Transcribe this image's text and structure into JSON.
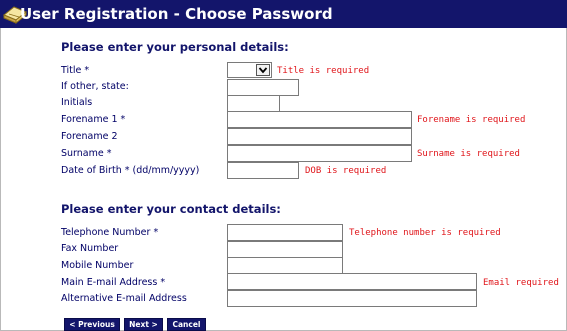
{
  "title": "User Registration - Choose Password",
  "personal": {
    "heading": "Please enter your personal details:",
    "fields": {
      "title": {
        "label": "Title *",
        "error": "Title is required",
        "value": ""
      },
      "other_state": {
        "label": "If other, state:",
        "value": ""
      },
      "initials": {
        "label": "Initials",
        "value": ""
      },
      "forename1": {
        "label": "Forename 1 *",
        "error": "Forename is required",
        "value": ""
      },
      "forename2": {
        "label": "Forename 2",
        "value": ""
      },
      "surname": {
        "label": "Surname *",
        "error": "Surname is required",
        "value": ""
      },
      "dob": {
        "label": "Date of Birth * (dd/mm/yyyy)",
        "error": "DOB is required",
        "value": ""
      }
    }
  },
  "contact": {
    "heading": "Please enter your contact details:",
    "fields": {
      "telephone": {
        "label": "Telephone Number *",
        "error": "Telephone number is required",
        "value": ""
      },
      "fax": {
        "label": "Fax Number",
        "value": ""
      },
      "mobile": {
        "label": "Mobile Number",
        "value": ""
      },
      "email": {
        "label": "Main E-mail Address *",
        "error": "Email required",
        "value": ""
      },
      "alt_email": {
        "label": "Alternative E-mail Address",
        "value": ""
      }
    }
  },
  "buttons": {
    "previous": "< Previous",
    "next": "Next >",
    "cancel": "Cancel"
  },
  "icons": {
    "title": "book-icon",
    "dropdown": "chevron-down-icon"
  },
  "colors": {
    "header_bg": "#13156b",
    "error": "#e0161b",
    "label": "#000066"
  }
}
